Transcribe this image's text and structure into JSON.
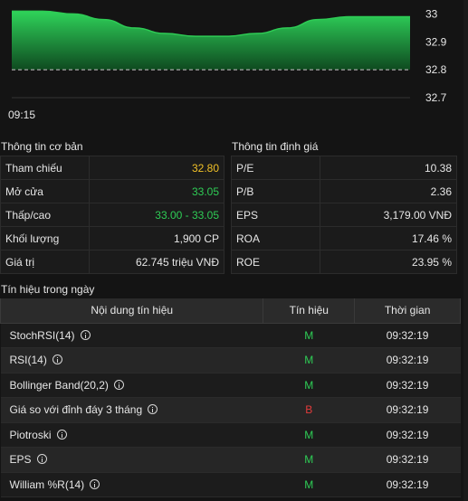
{
  "chart_data": {
    "type": "area",
    "x": [
      "09:15"
    ],
    "series": [
      {
        "values": [
          33.01,
          33.01,
          33.0,
          32.98,
          32.95,
          32.93,
          32.92,
          32.92,
          32.93,
          32.95,
          32.98,
          32.99,
          32.99,
          32.99
        ]
      }
    ],
    "reference_line": 32.8,
    "ylim": [
      32.7,
      33.05
    ],
    "yticks": [
      "33",
      "32.9",
      "32.8",
      "32.7"
    ],
    "xlabel_time": "09:15",
    "line_color": "#2ecc55",
    "ref_line_color": "#cccccc"
  },
  "basic": {
    "title": "Thông tin cơ bản",
    "rows": [
      {
        "label": "Tham chiếu",
        "value": "32.80",
        "color": "yellow"
      },
      {
        "label": "Mở cửa",
        "value": "33.05",
        "color": "green"
      },
      {
        "label": "Thấp/cao",
        "value": "33.00 - 33.05",
        "color": "green"
      },
      {
        "label": "Khối lượng",
        "value": "1,900 CP",
        "color": ""
      },
      {
        "label": "Giá trị",
        "value": "62.745 triệu VNĐ",
        "color": ""
      }
    ]
  },
  "valuation": {
    "title": "Thông tin định giá",
    "rows": [
      {
        "label": "P/E",
        "value": "10.38"
      },
      {
        "label": "P/B",
        "value": "2.36"
      },
      {
        "label": "EPS",
        "value": "3,179.00 VNĐ"
      },
      {
        "label": "ROA",
        "value": "17.46 %"
      },
      {
        "label": "ROE",
        "value": "23.95 %"
      }
    ]
  },
  "signals": {
    "title": "Tín hiệu trong ngày",
    "headers": [
      "Nội dung tín hiệu",
      "Tín hiệu",
      "Thời gian"
    ],
    "rows": [
      {
        "name": "StochRSI(14)",
        "signal": "M",
        "time": "09:32:19"
      },
      {
        "name": "RSI(14)",
        "signal": "M",
        "time": "09:32:19"
      },
      {
        "name": "Bollinger Band(20,2)",
        "signal": "M",
        "time": "09:32:19"
      },
      {
        "name": "Giá so với đỉnh đáy 3 tháng",
        "signal": "B",
        "time": "09:32:19"
      },
      {
        "name": "Piotroski",
        "signal": "M",
        "time": "09:32:19"
      },
      {
        "name": "EPS",
        "signal": "M",
        "time": "09:32:19"
      },
      {
        "name": "William %R(14)",
        "signal": "M",
        "time": "09:32:19"
      }
    ]
  }
}
